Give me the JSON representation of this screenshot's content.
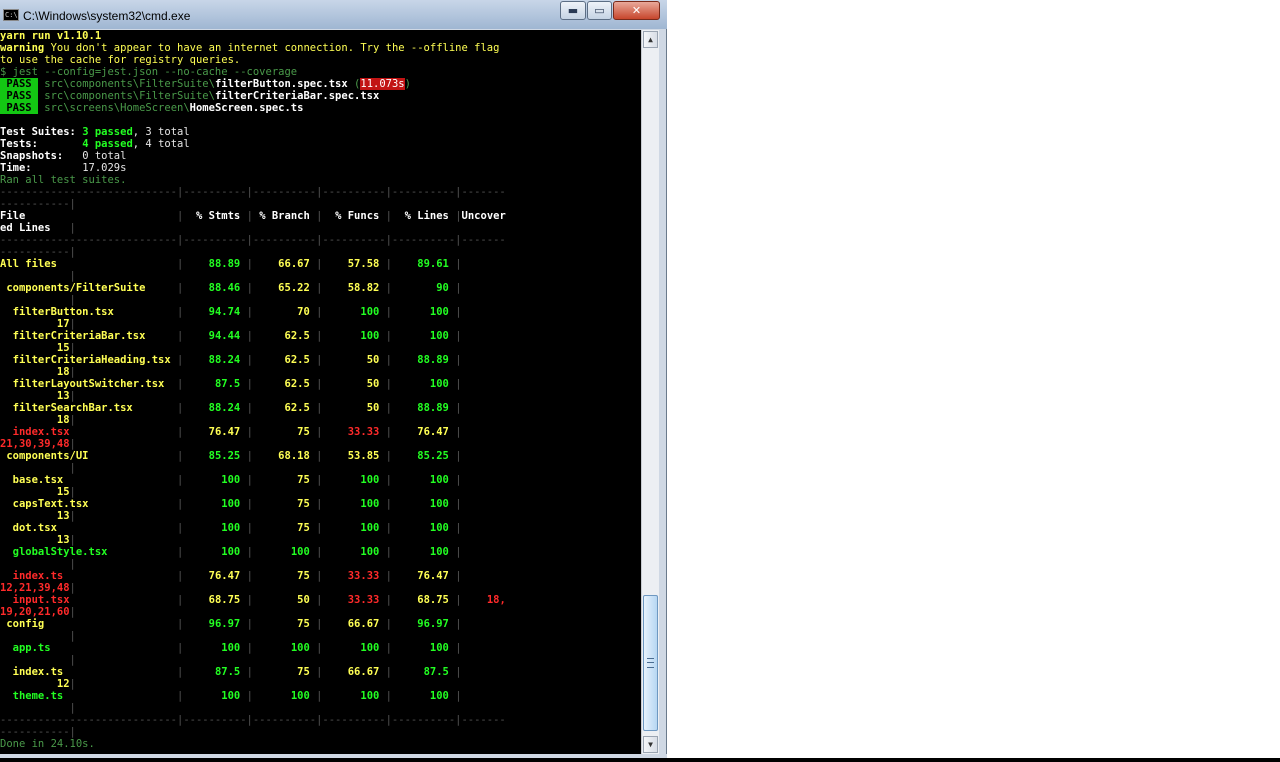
{
  "window": {
    "title": "C:\\Windows\\system32\\cmd.exe",
    "icon_label": "C:\\",
    "minimize_glyph": "▬",
    "maximize_glyph": "▭",
    "close_glyph": "✕"
  },
  "header": [
    "yarn run v1.10.1",
    "warning You don't appear to have an internet connection. Try the --offline flag",
    "to use the cache for registry queries.",
    "$ jest --config=jest.json --no-cache --coverage"
  ],
  "tests": [
    {
      "status": "PASS",
      "dir": "src\\components\\FilterSuite\\",
      "file": "filterButton.spec.tsx",
      "time": "11.073s"
    },
    {
      "status": "PASS",
      "dir": "src\\components\\FilterSuite\\",
      "file": "filterCriteriaBar.spec.tsx",
      "time": ""
    },
    {
      "status": "PASS",
      "dir": "src\\screens\\HomeScreen\\",
      "file": "HomeScreen.spec.ts",
      "time": ""
    }
  ],
  "summary": {
    "suites_label": "Test Suites:",
    "suites_passed": "3 passed",
    "suites_total": ", 3 total",
    "tests_label": "Tests:",
    "tests_passed": "4 passed",
    "tests_total": ", 4 total",
    "snapshots_label": "Snapshots:",
    "snapshots_value": "0 total",
    "time_label": "Time:",
    "time_value": "17.029s",
    "ran_all": "Ran all test suites."
  },
  "coverage_table": {
    "columns": [
      "File",
      "% Stmts",
      "% Branch",
      "% Funcs",
      "% Lines",
      "Uncovered Lines"
    ],
    "rows": [
      {
        "file": "All files",
        "indent": 0,
        "stmts": "88.89",
        "branch": "66.67",
        "funcs": "57.58",
        "lines": "89.61",
        "uncovered": ""
      },
      {
        "file": "components/FilterSuite",
        "indent": 1,
        "stmts": "88.46",
        "branch": "65.22",
        "funcs": "58.82",
        "lines": "90",
        "uncovered": ""
      },
      {
        "file": "filterButton.tsx",
        "indent": 2,
        "stmts": "94.74",
        "branch": "70",
        "funcs": "100",
        "lines": "100",
        "uncovered": "17"
      },
      {
        "file": "filterCriteriaBar.tsx",
        "indent": 2,
        "stmts": "94.44",
        "branch": "62.5",
        "funcs": "100",
        "lines": "100",
        "uncovered": "15"
      },
      {
        "file": "filterCriteriaHeading.tsx",
        "indent": 2,
        "stmts": "88.24",
        "branch": "62.5",
        "funcs": "50",
        "lines": "88.89",
        "uncovered": "18"
      },
      {
        "file": "filterLayoutSwitcher.tsx",
        "indent": 2,
        "stmts": "87.5",
        "branch": "62.5",
        "funcs": "50",
        "lines": "100",
        "uncovered": "13"
      },
      {
        "file": "filterSearchBar.tsx",
        "indent": 2,
        "stmts": "88.24",
        "branch": "62.5",
        "funcs": "50",
        "lines": "88.89",
        "uncovered": "18"
      },
      {
        "file": "index.tsx",
        "indent": 2,
        "stmts": "76.47",
        "branch": "75",
        "funcs": "33.33",
        "lines": "76.47",
        "uncovered": "21,30,39,48"
      },
      {
        "file": "components/UI",
        "indent": 1,
        "stmts": "85.25",
        "branch": "68.18",
        "funcs": "53.85",
        "lines": "85.25",
        "uncovered": ""
      },
      {
        "file": "base.tsx",
        "indent": 2,
        "stmts": "100",
        "branch": "75",
        "funcs": "100",
        "lines": "100",
        "uncovered": "15"
      },
      {
        "file": "capsText.tsx",
        "indent": 2,
        "stmts": "100",
        "branch": "75",
        "funcs": "100",
        "lines": "100",
        "uncovered": "13"
      },
      {
        "file": "dot.tsx",
        "indent": 2,
        "stmts": "100",
        "branch": "75",
        "funcs": "100",
        "lines": "100",
        "uncovered": "13"
      },
      {
        "file": "globalStyle.tsx",
        "indent": 2,
        "stmts": "100",
        "branch": "100",
        "funcs": "100",
        "lines": "100",
        "uncovered": ""
      },
      {
        "file": "index.ts",
        "indent": 2,
        "stmts": "76.47",
        "branch": "75",
        "funcs": "33.33",
        "lines": "76.47",
        "uncovered": "12,21,39,48"
      },
      {
        "file": "input.tsx",
        "indent": 2,
        "stmts": "68.75",
        "branch": "50",
        "funcs": "33.33",
        "lines": "68.75",
        "uncovered": "18,19,20,21,60"
      },
      {
        "file": "config",
        "indent": 1,
        "stmts": "96.97",
        "branch": "75",
        "funcs": "66.67",
        "lines": "96.97",
        "uncovered": ""
      },
      {
        "file": "app.ts",
        "indent": 2,
        "stmts": "100",
        "branch": "100",
        "funcs": "100",
        "lines": "100",
        "uncovered": ""
      },
      {
        "file": "index.ts",
        "indent": 2,
        "stmts": "87.5",
        "branch": "75",
        "funcs": "66.67",
        "lines": "87.5",
        "uncovered": "12"
      },
      {
        "file": "theme.ts",
        "indent": 2,
        "stmts": "100",
        "branch": "100",
        "funcs": "100",
        "lines": "100",
        "uncovered": ""
      }
    ]
  },
  "footer": "Done in 24.10s.",
  "colors": {
    "console_bg": "#000000",
    "high": "#19e619",
    "medium": "#ffff54",
    "low": "#ff2a2a",
    "pass_bg": "#13c713"
  }
}
